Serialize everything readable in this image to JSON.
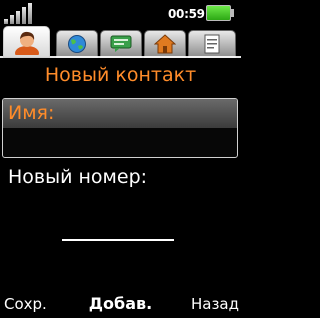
{
  "status_bar": {
    "signal_icon": "signal-bars-icon",
    "time": "00:59",
    "battery_icon": "battery-icon",
    "battery_level": 1.0
  },
  "tabs": [
    {
      "icon": "contact-person-icon",
      "active": true
    },
    {
      "icon": "globe-icon",
      "active": false
    },
    {
      "icon": "message-bubble-icon",
      "active": false
    },
    {
      "icon": "home-icon",
      "active": false
    },
    {
      "icon": "notepad-icon",
      "active": false
    }
  ],
  "screen": {
    "title": "Новый контакт",
    "name_field_label": "Имя:",
    "new_number_label": "Новый номер:"
  },
  "softkeys": {
    "left": "Сохр.",
    "center": "Добав.",
    "right": "Назад"
  },
  "colors": {
    "accent": "#ff8c2a",
    "background": "#000000",
    "text": "#ffffff"
  }
}
